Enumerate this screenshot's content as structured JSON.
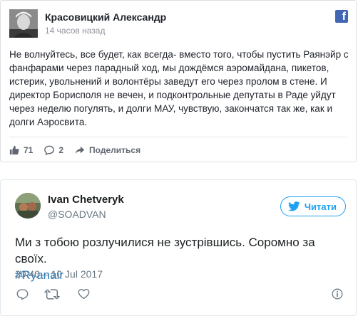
{
  "facebook_post": {
    "author": "Красовицкий Александр",
    "timestamp": "14 часов назад",
    "brand_icon": "facebook-f-icon",
    "text": "Не волнуйтесь, все будет, как всегда- вместо того, чтобы пустить Раянэйр с фанфарами через парадный ход, мы дождёмся аэромайдана, пикетов, истерик, увольнений и волонтёры заведут его через пролом в стене. И директор Борисполя не вечен, и подконтрольные депутаты в Раде уйдут через неделю погулять, и долги МАУ, чувствую, закончатся так же, как и долги Аэросвита.",
    "likes": "71",
    "comments": "2",
    "share_label": "Поделиться",
    "colors": {
      "brand": "#4267b2",
      "meta": "#90949c",
      "action": "#606770"
    }
  },
  "tweet": {
    "name": "Ivan Chetveryk",
    "handle": "@SOADVAN",
    "follow_label": "Читати",
    "text": "Ми з тобою розлучилися не зустрівшись. Соромно за своїх.",
    "hashtag": "#Ryanair",
    "date": "20:40 – 10 Jul 2017",
    "colors": {
      "accent": "#1da1f2",
      "link": "#2b7bb9",
      "meta": "#697882"
    }
  }
}
